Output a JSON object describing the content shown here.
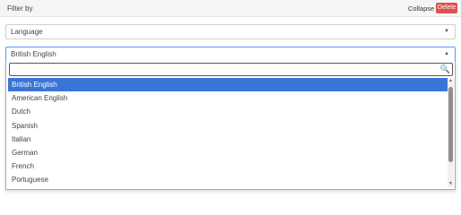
{
  "header": {
    "title": "Filter by",
    "collapse_label": "Collapse",
    "delete_label": "Delete"
  },
  "language_select": {
    "value": "Language",
    "arrow": "▼"
  },
  "variant_select": {
    "value": "British English",
    "arrow": "▲"
  },
  "dropdown": {
    "search_value": "",
    "search_icon": "🔍",
    "options": [
      {
        "label": "British English",
        "highlighted": true
      },
      {
        "label": "American English",
        "highlighted": false
      },
      {
        "label": "Dutch",
        "highlighted": false
      },
      {
        "label": "Spanish",
        "highlighted": false
      },
      {
        "label": "Italian",
        "highlighted": false
      },
      {
        "label": "German",
        "highlighted": false
      },
      {
        "label": "French",
        "highlighted": false
      },
      {
        "label": "Portuguese",
        "highlighted": false
      }
    ],
    "scroll_up": "▲",
    "scroll_down": "▼"
  },
  "colors": {
    "highlight": "#3875d7",
    "delete_button": "#d9534f",
    "focus_border": "#5897fb"
  }
}
